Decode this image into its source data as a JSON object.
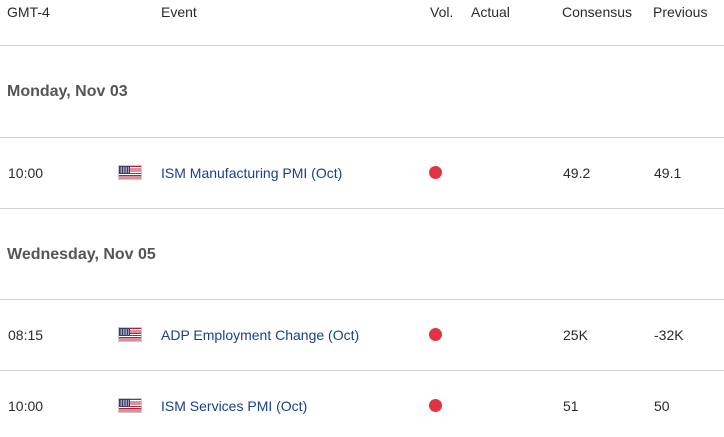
{
  "header": {
    "timezone": "GMT-4",
    "event": "Event",
    "vol": "Vol.",
    "actual": "Actual",
    "consensus": "Consensus",
    "previous": "Previous"
  },
  "days": [
    {
      "label": "Monday, Nov 03",
      "events": [
        {
          "time": "10:00",
          "flag_icon": "us-flag-icon",
          "name": "ISM Manufacturing PMI (Oct)",
          "volatility": "high",
          "volatility_color": "#e03444",
          "actual": "",
          "consensus": "49.2",
          "previous": "49.1"
        }
      ]
    },
    {
      "label": "Wednesday, Nov 05",
      "events": [
        {
          "time": "08:15",
          "flag_icon": "us-flag-icon",
          "name": "ADP Employment Change (Oct)",
          "volatility": "high",
          "volatility_color": "#e03444",
          "actual": "",
          "consensus": "25K",
          "previous": "-32K"
        },
        {
          "time": "10:00",
          "flag_icon": "us-flag-icon",
          "name": "ISM Services PMI (Oct)",
          "volatility": "high",
          "volatility_color": "#e03444",
          "actual": "",
          "consensus": "51",
          "previous": "50"
        }
      ]
    }
  ]
}
